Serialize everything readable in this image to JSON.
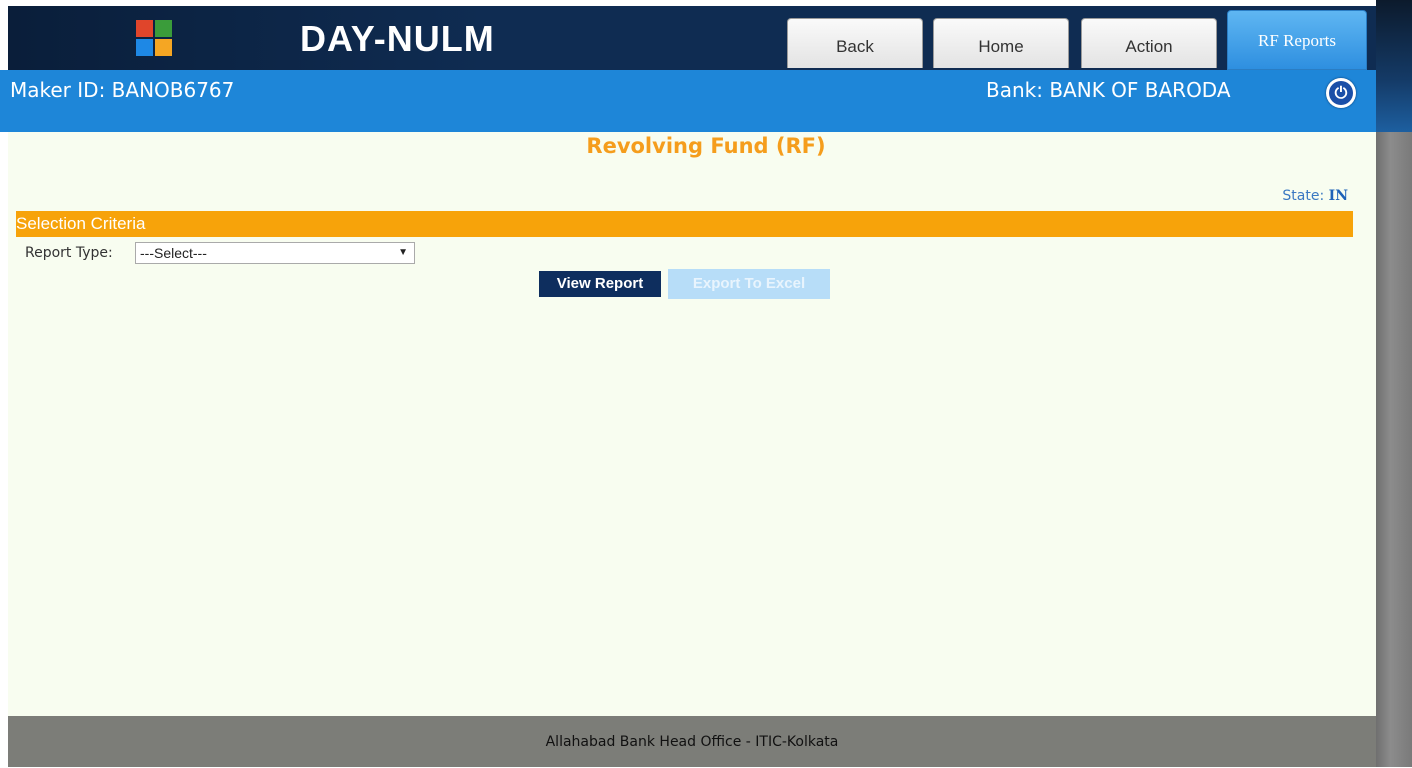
{
  "header": {
    "app_title": "DAY-NULM",
    "tabs": [
      {
        "label": "Back"
      },
      {
        "label": "Home"
      },
      {
        "label": "Action"
      },
      {
        "label": "RF Reports"
      }
    ],
    "active_tab": "RF Reports"
  },
  "infobar": {
    "maker": "Maker ID: BANOB6767",
    "bank": "Bank: BANK OF BARODA"
  },
  "main": {
    "title": "Revolving Fund (RF)",
    "state_label": "State: ",
    "state_value": "IN",
    "section_title": "Selection Criteria",
    "report_type_label": "Report Type:",
    "report_type_value": "---Select---",
    "view_button": "View Report",
    "export_button": "Export To Excel"
  },
  "footer": {
    "text": "Allahabad Bank Head Office - ITIC-Kolkata"
  },
  "colors": {
    "header_bg": "#0f2c52",
    "infobar_bg": "#1e86d8",
    "accent_orange": "#f7a30a",
    "content_bg": "#f8fdf0",
    "footer_bg": "#7c7d78"
  }
}
